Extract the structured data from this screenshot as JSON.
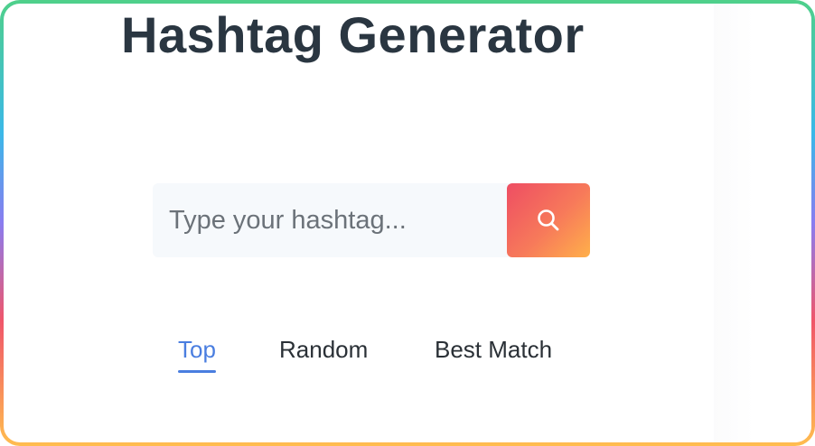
{
  "page": {
    "title": "Hashtag Generator"
  },
  "search": {
    "placeholder": "Type your hashtag...",
    "value": "",
    "button_icon": "search-icon"
  },
  "tabs": [
    {
      "label": "Top",
      "active": true
    },
    {
      "label": "Random",
      "active": false
    },
    {
      "label": "Best Match",
      "active": false
    }
  ],
  "colors": {
    "title": "#2a3641",
    "accent": "#4a7ee0",
    "button_gradient_start": "#ee4d63",
    "button_gradient_end": "#ffb04a",
    "input_background": "#f6f9fc"
  }
}
